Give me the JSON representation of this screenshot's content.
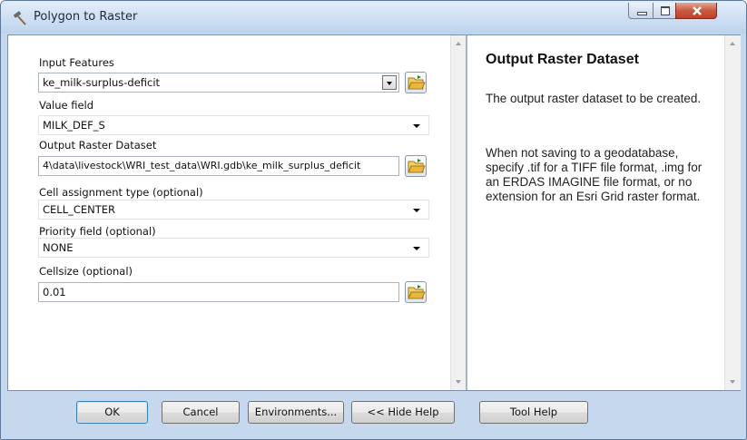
{
  "window": {
    "title": "Polygon to Raster",
    "icon": "hammer-tool-icon"
  },
  "form": {
    "input_features": {
      "label": "Input Features",
      "value": "ke_milk-surplus-deficit"
    },
    "value_field": {
      "label": "Value field",
      "value": "MILK_DEF_S"
    },
    "output_raster": {
      "label": "Output Raster Dataset",
      "value": "4\\data\\livestock\\WRI_test_data\\WRI.gdb\\ke_milk_surplus_deficit"
    },
    "cell_assignment": {
      "label": "Cell assignment type (optional)",
      "value": "CELL_CENTER"
    },
    "priority_field": {
      "label": "Priority field (optional)",
      "value": "NONE"
    },
    "cellsize": {
      "label": "Cellsize (optional)",
      "value": "0.01"
    }
  },
  "help": {
    "title": "Output Raster Dataset",
    "para1": "The output raster dataset to be created.",
    "para2": "When not saving to a geodatabase, specify .tif for a TIFF file format, .img for an ERDAS IMAGINE file format, or no extension for an Esri Grid raster format."
  },
  "buttons": {
    "ok": "OK",
    "cancel": "Cancel",
    "environments": "Environments...",
    "hide_help": "<< Hide Help",
    "tool_help": "Tool Help"
  },
  "colors": {
    "close_button": "#c7432b",
    "frame": "#c5d8ee",
    "folder": "#e8b73c"
  }
}
